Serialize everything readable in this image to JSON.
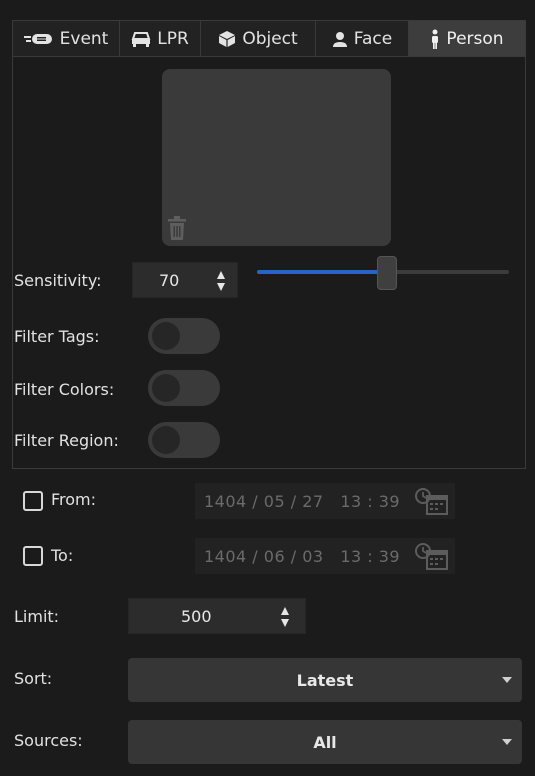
{
  "tabs": [
    {
      "label": "Event",
      "icon": "event-icon",
      "active": false
    },
    {
      "label": "LPR",
      "icon": "car-icon",
      "active": false
    },
    {
      "label": "Object",
      "icon": "cube-icon",
      "active": false
    },
    {
      "label": "Face",
      "icon": "face-icon",
      "active": false
    },
    {
      "label": "Person",
      "icon": "person-icon",
      "active": true
    }
  ],
  "person": {
    "sensitivity_label": "Sensitivity:",
    "sensitivity_value": "70",
    "sensitivity_level": 70,
    "filter_tags_label": "Filter Tags:",
    "filter_tags_on": false,
    "filter_colors_label": "Filter Colors:",
    "filter_colors_on": false,
    "filter_region_label": "Filter Region:",
    "filter_region_on": false
  },
  "from": {
    "label": "From:",
    "checked": false,
    "value": "1404 / 05 / 27   13 : 39"
  },
  "to": {
    "label": "To:",
    "checked": false,
    "value": "1404 / 06 / 03   13 : 39"
  },
  "limit": {
    "label": "Limit:",
    "value": "500"
  },
  "sort": {
    "label": "Sort:",
    "value": "Latest"
  },
  "sources": {
    "label": "Sources:",
    "value": "All"
  },
  "colors": {
    "accent": "#2a63c8",
    "background": "#1b1b1b",
    "tab_active": "#3d3d3d"
  }
}
